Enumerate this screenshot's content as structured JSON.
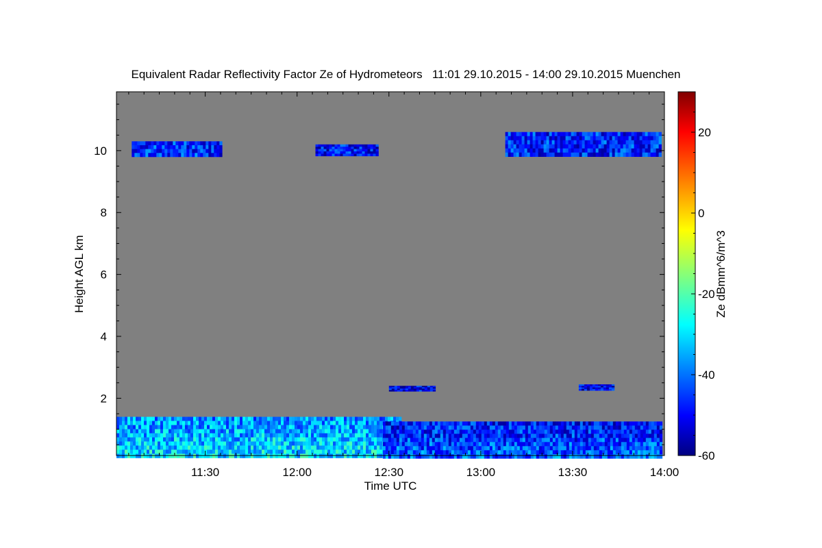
{
  "chart_data": {
    "type": "heatmap",
    "title": "Equivalent Radar Reflectivity Factor Ze of Hydrometeors   11:01 29.10.2015 - 14:00 29.10.2015 Muenchen",
    "xlabel": "Time UTC",
    "ylabel": "Height AGL km",
    "colorbar_label": "Ze dBmm^6/m^3",
    "xlim": [
      "11:01",
      "14:00"
    ],
    "ylim": [
      0.15,
      11.9
    ],
    "x_ticks": [
      "11:30",
      "12:00",
      "12:30",
      "13:00",
      "13:30",
      "14:00"
    ],
    "y_ticks": [
      2,
      4,
      6,
      8,
      10
    ],
    "colorbar_range": [
      -60,
      30
    ],
    "colorbar_ticks": [
      20,
      0,
      -20,
      -40,
      -60
    ],
    "background_color": "#808080",
    "colormap": "jet",
    "echo_regions": [
      {
        "time_start": "11:06",
        "time_end": "11:35",
        "height_bottom": 9.8,
        "height_top": 10.3,
        "ze": -45
      },
      {
        "time_start": "12:06",
        "time_end": "12:26",
        "height_bottom": 9.9,
        "height_top": 10.2,
        "ze": -48
      },
      {
        "time_start": "13:08",
        "time_end": "13:59",
        "height_bottom": 9.9,
        "height_top": 10.6,
        "ze": -46
      },
      {
        "time_start": "12:30",
        "time_end": "12:45",
        "height_bottom": 2.25,
        "height_top": 2.4,
        "ze": -50
      },
      {
        "time_start": "13:32",
        "time_end": "13:43",
        "height_bottom": 2.25,
        "height_top": 2.45,
        "ze": -50
      },
      {
        "time_start": "11:01",
        "time_end": "12:34",
        "height_bottom": 0.15,
        "height_top": 1.4,
        "ze": -28
      },
      {
        "time_start": "12:28",
        "time_end": "13:59",
        "height_bottom": 0.15,
        "height_top": 1.25,
        "ze": -40
      }
    ]
  }
}
